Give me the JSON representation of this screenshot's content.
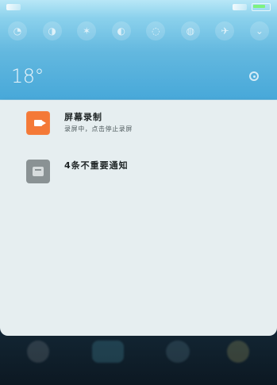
{
  "weather": {
    "temperature": "18°"
  },
  "notifications": [
    {
      "title": "屏幕录制",
      "subtitle": "录屏中，点击停止录屏",
      "icon": "screen-recorder-icon",
      "icon_color": "#f47937"
    },
    {
      "title": "4条不重要通知",
      "icon": "unimportant-notifications-icon",
      "icon_color": "#8a9294"
    }
  ],
  "colors": {
    "shade_top": "#63b8df",
    "panel_bg": "#e6eef0",
    "recorder_orange": "#f47937"
  }
}
